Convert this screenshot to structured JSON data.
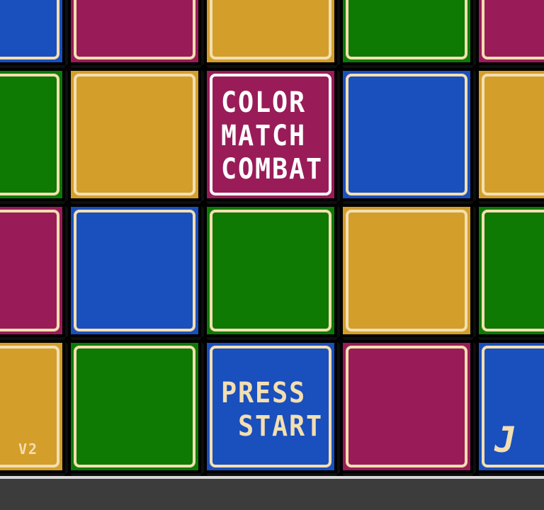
{
  "game": {
    "title_lines": [
      "COLOR",
      "MATCH",
      "COMBAT"
    ],
    "prompt_lines": [
      "PRESS",
      " START"
    ],
    "version_label": "V2",
    "corner_mark": "J"
  },
  "palette": {
    "blue": "#1a4fbe",
    "magenta": "#991c59",
    "gold": "#d49e2b",
    "green": "#0e7a04",
    "border_cream": "#f3dfb0",
    "title_border": "#ffffff"
  },
  "grid": {
    "rows": [
      [
        "blue",
        "magenta",
        "gold",
        "green",
        "magenta"
      ],
      [
        "green",
        "gold",
        "magenta",
        "blue",
        "gold"
      ],
      [
        "magenta",
        "blue",
        "green",
        "gold",
        "green"
      ],
      [
        "gold",
        "green",
        "blue",
        "magenta",
        "blue"
      ]
    ],
    "title_tile": [
      1,
      2
    ],
    "start_tile": [
      3,
      2
    ]
  }
}
